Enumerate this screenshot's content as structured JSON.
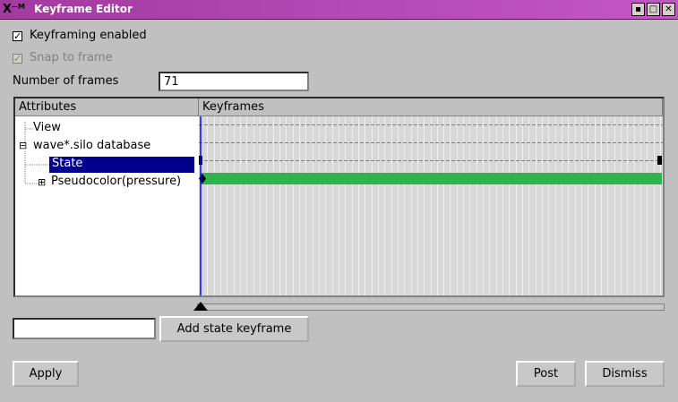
{
  "window": {
    "title": "Keyframe Editor",
    "controls": {
      "minimize": "▪",
      "maximize": "□",
      "close": "✕"
    }
  },
  "options": {
    "keyframing_enabled": {
      "label": "Keyframing enabled",
      "checked": true
    },
    "snap_to_frame": {
      "label": "Snap to frame",
      "checked": true,
      "enabled": false
    }
  },
  "frames": {
    "label": "Number of frames",
    "value": "71"
  },
  "panel": {
    "attributes_header": "Attributes",
    "keyframes_header": "Keyframes",
    "tree": [
      {
        "label": "View",
        "selected": false
      },
      {
        "label": "wave*.silo database",
        "selected": false,
        "expander": "⊟"
      },
      {
        "label": "State",
        "selected": true
      },
      {
        "label": "Pseudocolor(pressure)",
        "selected": false,
        "expander": "⊞"
      }
    ],
    "frame_count": 71,
    "current_frame": 0
  },
  "state_keyframe": {
    "input_value": "",
    "button_label": "Add state keyframe"
  },
  "footer": {
    "apply": "Apply",
    "post": "Post",
    "dismiss": "Dismiss"
  },
  "colors": {
    "title_bar": "#b44ab6",
    "selection": "#00008b",
    "bar": "#2fb34c",
    "cursor_line": "#0000ff"
  }
}
